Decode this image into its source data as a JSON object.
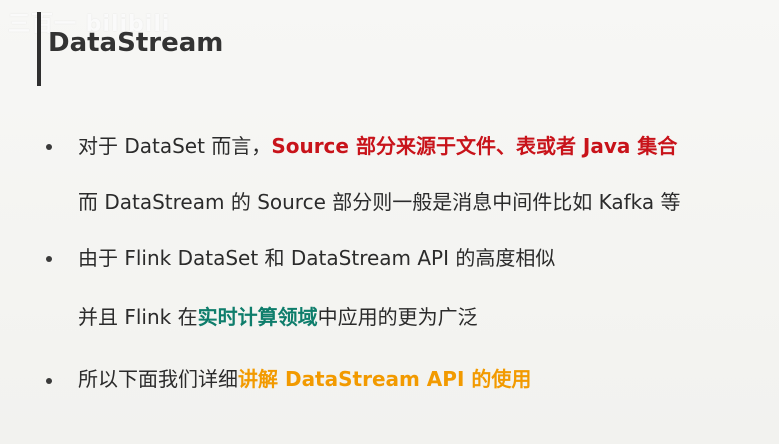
{
  "watermark": {
    "text": "三百一 bilibili"
  },
  "title": {
    "text": "DataStream"
  },
  "bullets": [
    {
      "line1": {
        "prefix": "对于 DataSet 而言，",
        "highlight": "Source 部分来源于文件、表或者 Java 集合"
      },
      "line2": {
        "text": "而 DataStream 的 Source 部分则一般是消息中间件比如 Kafka 等"
      }
    },
    {
      "line1": {
        "text": "由于 Flink DataSet 和 DataStream API 的高度相似"
      },
      "line2": {
        "prefix": "并且 Flink 在",
        "highlight": "实时计算领域",
        "suffix": "中应用的更为广泛"
      }
    },
    {
      "line1": {
        "prefix": "所以下面我们详细",
        "highlight": "讲解 DataStream API 的使用"
      }
    }
  ],
  "colors": {
    "red": "#c8131a",
    "teal": "#0e7d6b",
    "orange": "#f29a00"
  }
}
